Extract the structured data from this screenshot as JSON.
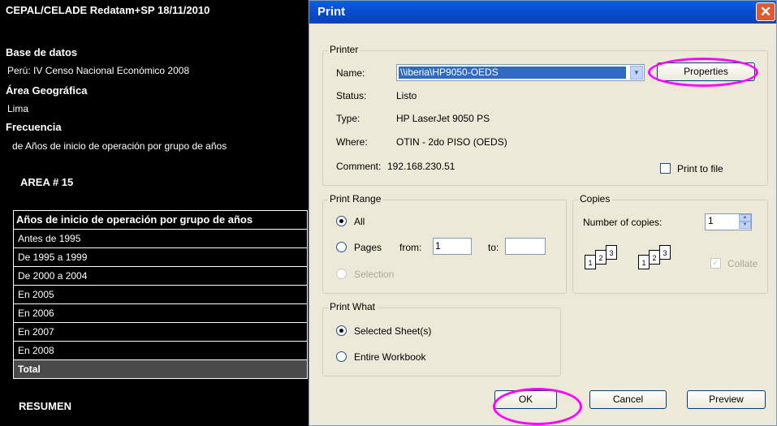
{
  "report": {
    "header": "CEPAL/CELADE Redatam+SP 18/11/2010",
    "db_label": "Base de datos",
    "db_value": "Perú: IV Censo Nacional Económico 2008",
    "area_label": "Área Geográfica",
    "area_value": "Lima",
    "freq_label": "Frecuencia",
    "freq_value": "de Años de inicio de operación por grupo de años",
    "area_number": "AREA # 15",
    "table_header": "Años de inicio de operación por grupo de años",
    "rows": [
      "Antes de 1995",
      "De 1995 a 1999",
      "De 2000 a 2004",
      "En 2005",
      "En 2006",
      "En 2007",
      "En 2008"
    ],
    "total": "Total",
    "summary": "RESUMEN"
  },
  "dialog": {
    "title": "Print",
    "close": "✕",
    "printer": {
      "legend": "Printer",
      "name_label": "Name:",
      "name_value": "\\\\iberia\\HP9050-OEDS",
      "properties": "Properties",
      "status_label": "Status:",
      "status_value": "Listo",
      "type_label": "Type:",
      "type_value": "HP LaserJet 9050 PS",
      "where_label": "Where:",
      "where_value": "OTIN - 2do PISO (OEDS)",
      "comment_label": "Comment:",
      "comment_value": "192.168.230.51",
      "print_to_file": "Print to file"
    },
    "range": {
      "legend": "Print Range",
      "all": "All",
      "pages": "Pages",
      "from_label": "from:",
      "from_value": "1",
      "to_label": "to:",
      "to_value": "",
      "selection": "Selection"
    },
    "copies": {
      "legend": "Copies",
      "number_label": "Number of copies:",
      "number_value": "1",
      "collate": "Collate"
    },
    "what": {
      "legend": "Print What",
      "selected": "Selected Sheet(s)",
      "entire": "Entire Workbook"
    },
    "buttons": {
      "ok": "OK",
      "cancel": "Cancel",
      "preview": "Preview"
    }
  },
  "colors": {
    "highlight": "#ff00ff",
    "title_bar": "#0b4ed0",
    "selection": "#316ac5"
  }
}
